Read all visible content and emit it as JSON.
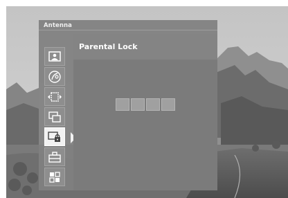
{
  "osd": {
    "source_label": "Antenna",
    "title": "Parental Lock"
  },
  "menu_rail": {
    "items": [
      {
        "icon": "picture-icon",
        "selected": false
      },
      {
        "icon": "sound-icon",
        "selected": false
      },
      {
        "icon": "screen-size-icon",
        "selected": false
      },
      {
        "icon": "pip-icon",
        "selected": false
      },
      {
        "icon": "lock-icon",
        "selected": true
      },
      {
        "icon": "setup-icon",
        "selected": false
      },
      {
        "icon": "apps-icon",
        "selected": false
      }
    ]
  },
  "pin_entry": {
    "digits": [
      "",
      "",
      "",
      ""
    ]
  },
  "colors": {
    "panel": "#808080",
    "selected": "#f2f2f2",
    "text": "#ffffff"
  }
}
